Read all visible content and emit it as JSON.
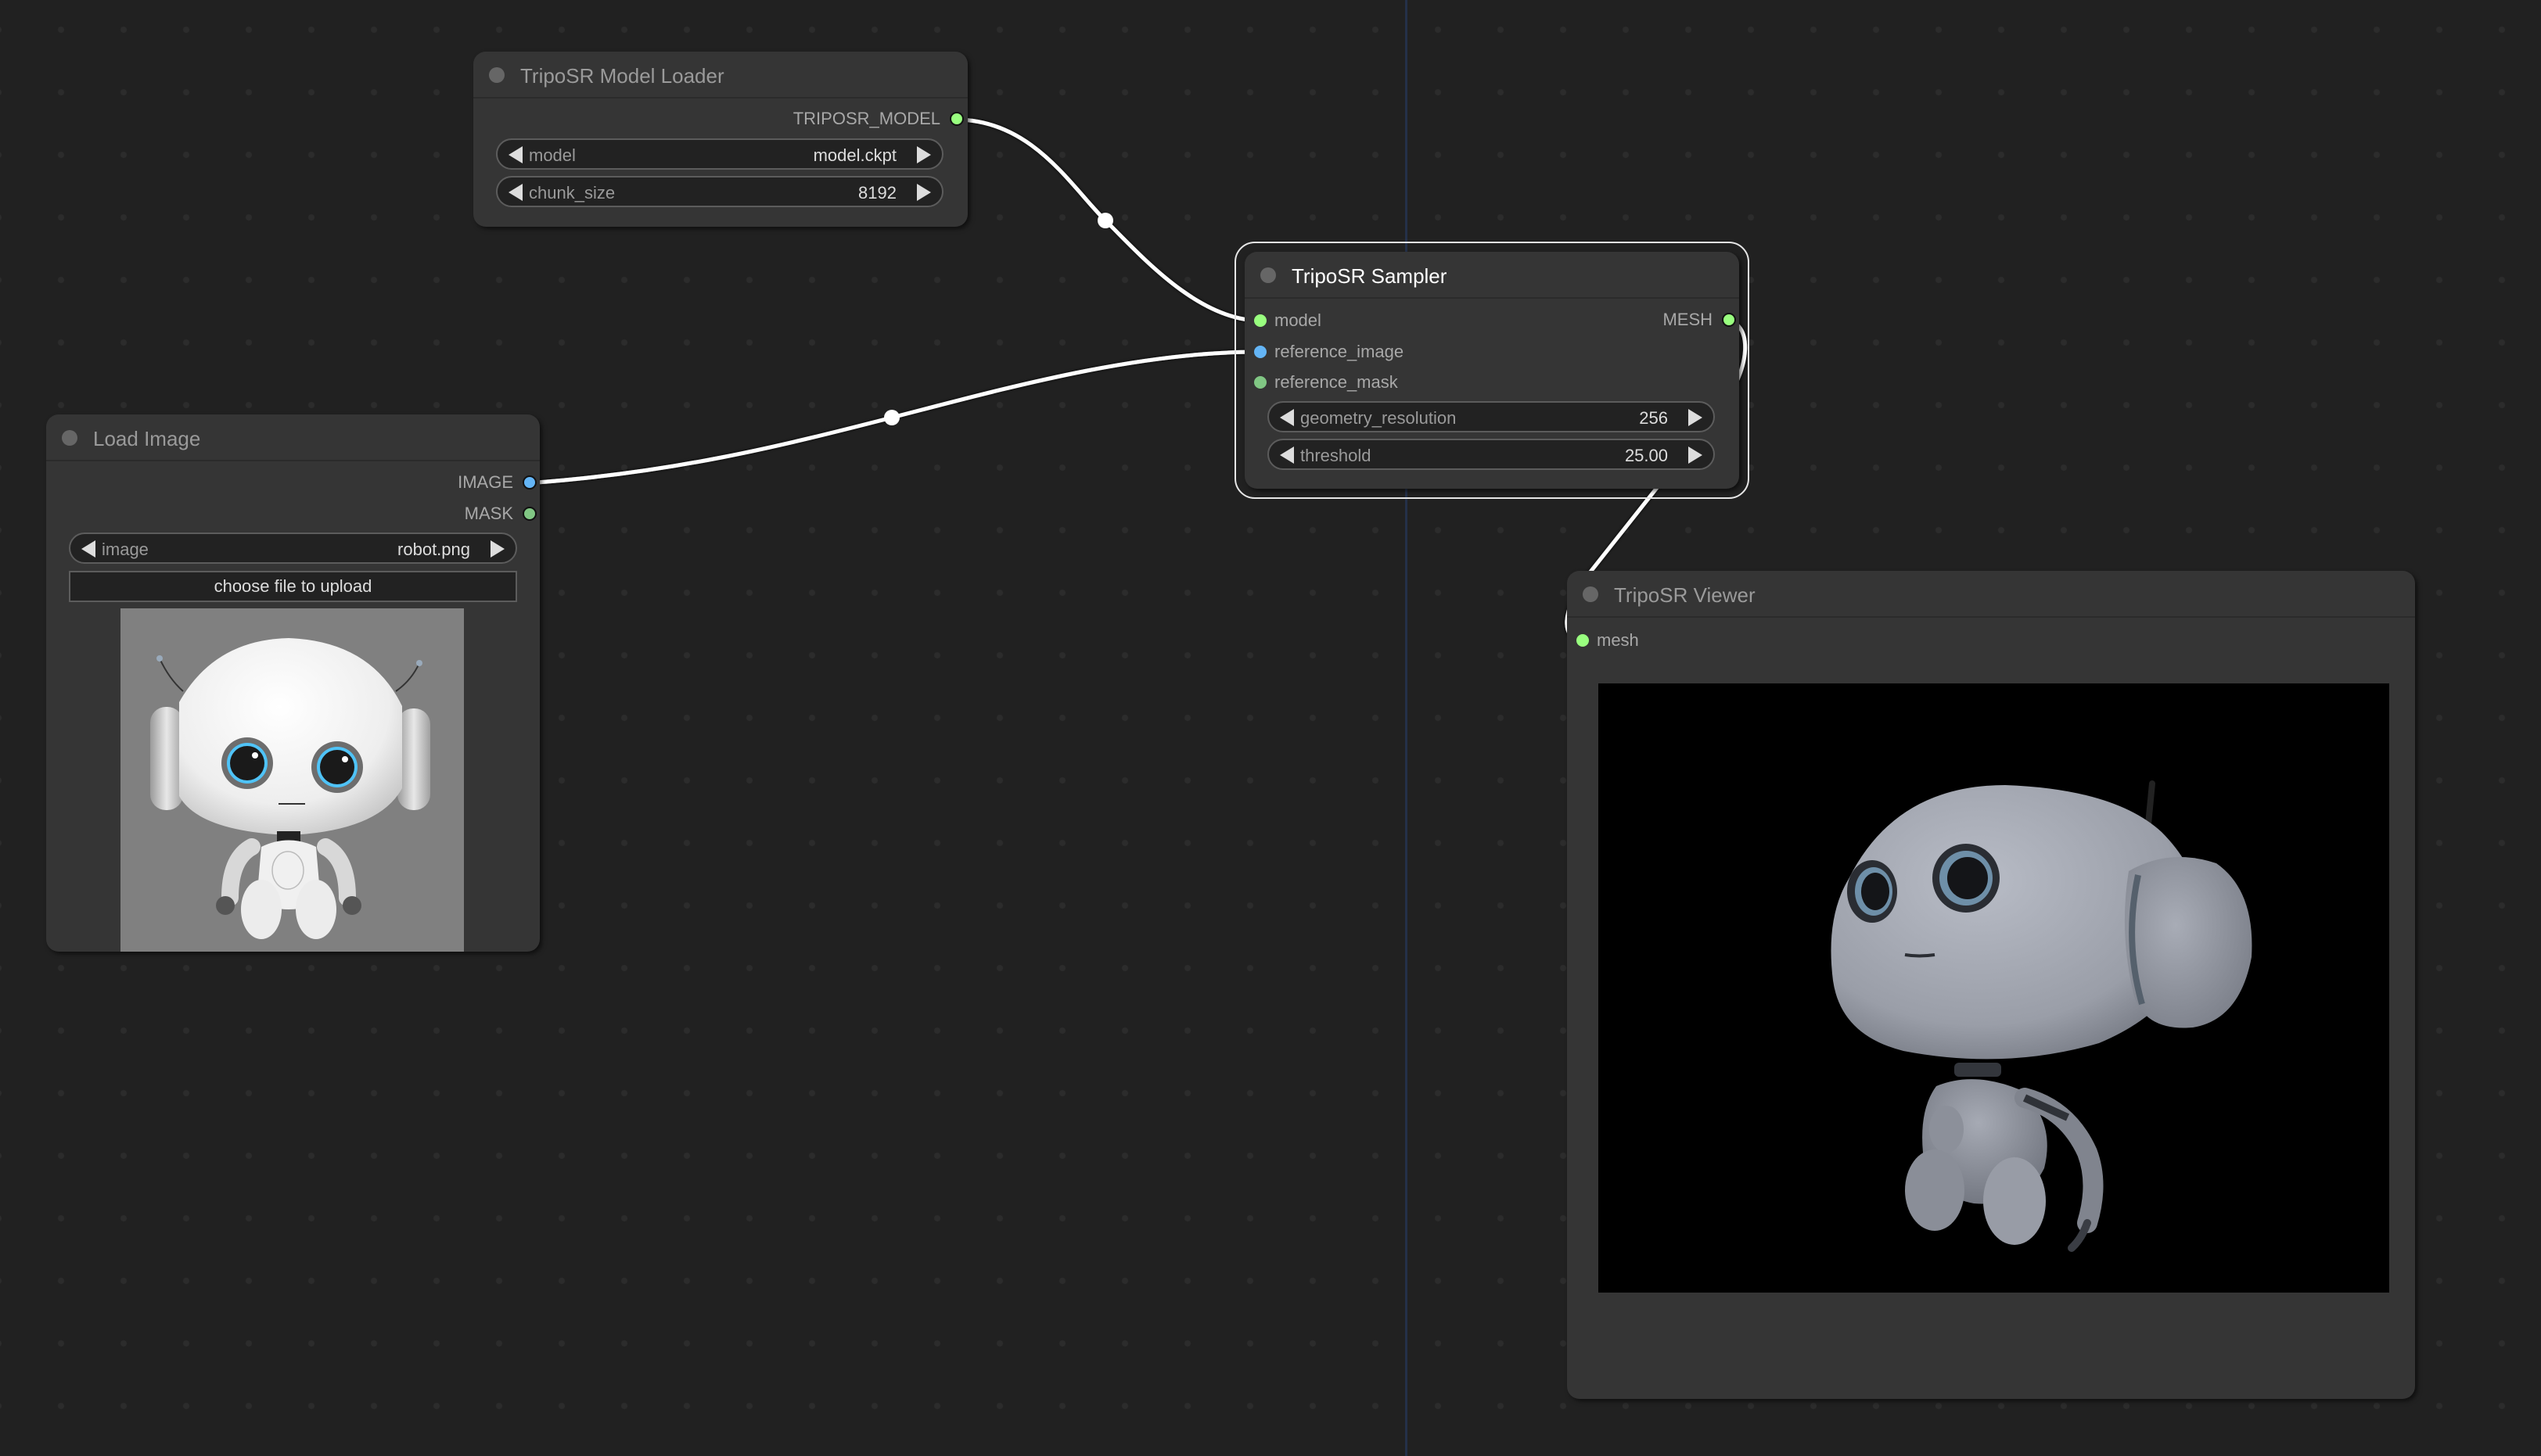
{
  "nodes": {
    "model_loader": {
      "title": "TripoSR Model Loader",
      "outputs": [
        {
          "label": "TRIPOSR_MODEL",
          "color": "#99ff7f"
        }
      ],
      "widgets": [
        {
          "label": "model",
          "value": "model.ckpt"
        },
        {
          "label": "chunk_size",
          "value": "8192"
        }
      ]
    },
    "load_image": {
      "title": "Load Image",
      "outputs": [
        {
          "label": "IMAGE",
          "color": "#64b5f6"
        },
        {
          "label": "MASK",
          "color": "#81c784"
        }
      ],
      "widgets": [
        {
          "label": "image",
          "value": "robot.png"
        }
      ],
      "upload_label": "choose file to upload",
      "preview_alt": "robot.png preview"
    },
    "sampler": {
      "title": "TripoSR Sampler",
      "selected": true,
      "inputs": [
        {
          "label": "model",
          "color": "#99ff7f"
        },
        {
          "label": "reference_image",
          "color": "#64b5f6"
        },
        {
          "label": "reference_mask",
          "color": "#81c784"
        }
      ],
      "outputs": [
        {
          "label": "MESH",
          "color": "#99ff7f"
        }
      ],
      "widgets": [
        {
          "label": "geometry_resolution",
          "value": "256"
        },
        {
          "label": "threshold",
          "value": "25.00"
        }
      ]
    },
    "viewer": {
      "title": "TripoSR Viewer",
      "inputs": [
        {
          "label": "mesh",
          "color": "#99ff7f"
        }
      ],
      "viewport_alt": "3D mesh render of robot"
    }
  },
  "links": [
    {
      "from": "TripoSR Model Loader.TRIPOSR_MODEL",
      "to": "TripoSR Sampler.model"
    },
    {
      "from": "Load Image.IMAGE",
      "to": "TripoSR Sampler.reference_image"
    },
    {
      "from": "TripoSR Sampler.MESH",
      "to": "TripoSR Viewer.mesh"
    }
  ],
  "colors": {
    "canvas_bg": "#212121",
    "node_bg": "#353535",
    "link": "#ffffff",
    "selection_outline": "#e6e6e6"
  }
}
